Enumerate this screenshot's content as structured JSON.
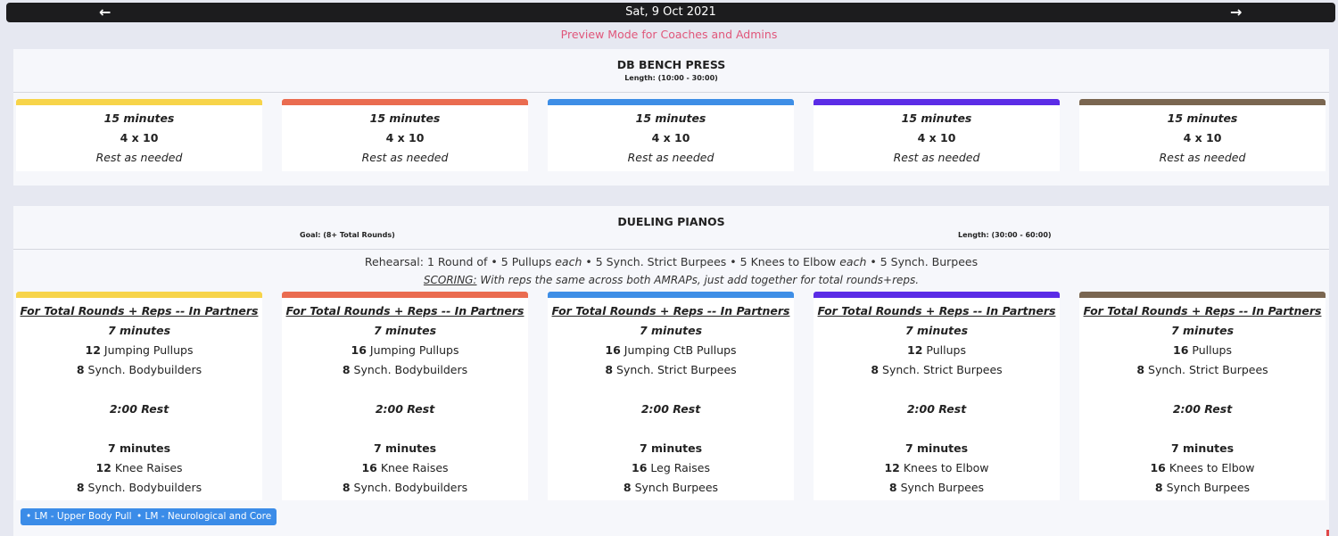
{
  "nav": {
    "date": "Sat, 9 Oct 2021",
    "prev_icon": "←",
    "next_icon": "→",
    "preview_notice": "Preview Mode for Coaches and Admins"
  },
  "colors": {
    "track_1": "#f7d44a",
    "track_2": "#ea6c50",
    "track_3": "#3e8ee6",
    "track_4": "#5b2ce6",
    "track_5": "#7a6650",
    "tag": "#3b8ce8",
    "notice": "#e0567a"
  },
  "section1": {
    "title": "DB BENCH PRESS",
    "length": "Length: (10:00 - 30:00)",
    "cards": [
      {
        "time": "15 minutes",
        "sets": "4 x 10",
        "rest": "Rest as needed"
      },
      {
        "time": "15 minutes",
        "sets": "4 x 10",
        "rest": "Rest as needed"
      },
      {
        "time": "15 minutes",
        "sets": "4 x 10",
        "rest": "Rest as needed"
      },
      {
        "time": "15 minutes",
        "sets": "4 x 10",
        "rest": "Rest as needed"
      },
      {
        "time": "15 minutes",
        "sets": "4 x 10",
        "rest": "Rest as needed"
      }
    ]
  },
  "section2": {
    "title": "DUELING PIANOS",
    "goal": "Goal: (8+ Total Rounds)",
    "length": "Length: (30:00 - 60:00)",
    "rehearsal": {
      "lead": "Rehearsal: 1 Round of • ",
      "n1": "5",
      "m1": " Pullups ",
      "e1": "each",
      "s1": " • ",
      "n2": "5",
      "m2": " Synch. Strict Burpees",
      "s2": " • ",
      "n3": "5",
      "m3": " Knees to Elbow ",
      "e3": "each",
      "s3": " • ",
      "n4": "5",
      "m4": " Synch. Burpees"
    },
    "scoring_label": "SCORING:",
    "scoring_text": " With reps the same across both AMRAPs, just add together for total rounds+reps.",
    "cards": [
      {
        "header": "For Total Rounds + Reps -- In Partners",
        "time1": "7 minutes",
        "r1n": "12",
        "r1m": " Jumping Pullups",
        "r2n": "8",
        "r2m": " Synch. Bodybuilders",
        "rest": "2:00 Rest",
        "time2": "7 minutes",
        "r3n": "12",
        "r3m": " Knee Raises",
        "r4n": "8",
        "r4m": " Synch. Bodybuilders"
      },
      {
        "header": "For Total Rounds + Reps -- In Partners",
        "time1": "7 minutes",
        "r1n": "16",
        "r1m": " Jumping Pullups",
        "r2n": "8",
        "r2m": " Synch. Bodybuilders",
        "rest": "2:00 Rest",
        "time2": "7 minutes",
        "r3n": "16",
        "r3m": " Knee Raises",
        "r4n": "8",
        "r4m": " Synch. Bodybuilders"
      },
      {
        "header": "For Total Rounds + Reps -- In Partners",
        "time1": "7 minutes",
        "r1n": "16",
        "r1m": " Jumping CtB Pullups",
        "r2n": "8",
        "r2m": " Synch. Strict Burpees",
        "rest": "2:00 Rest",
        "time2": "7 minutes",
        "r3n": "16",
        "r3m": " Leg Raises",
        "r4n": "8",
        "r4m": " Synch Burpees"
      },
      {
        "header": "For Total Rounds + Reps -- In Partners",
        "time1": "7 minutes",
        "r1n": "12",
        "r1m": " Pullups",
        "r2n": "8",
        "r2m": " Synch. Strict Burpees",
        "rest": "2:00 Rest",
        "time2": "7 minutes",
        "r3n": "12",
        "r3m": " Knees to Elbow",
        "r4n": "8",
        "r4m": " Synch Burpees"
      },
      {
        "header": "For Total Rounds + Reps -- In Partners",
        "time1": "7 minutes",
        "r1n": "16",
        "r1m": " Pullups",
        "r2n": "8",
        "r2m": " Synch. Strict Burpees",
        "rest": "2:00 Rest",
        "time2": "7 minutes",
        "r3n": "16",
        "r3m": " Knees to Elbow",
        "r4n": "8",
        "r4m": " Synch Burpees"
      }
    ],
    "tags": [
      "• LM - Upper Body Pull",
      "• LM - Neurological and Core"
    ]
  }
}
